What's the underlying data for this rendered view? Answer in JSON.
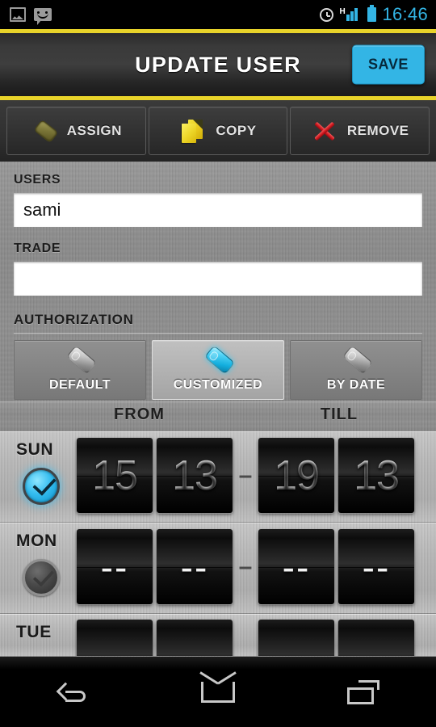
{
  "statusbar": {
    "icons": [
      "gallery-icon",
      "sms-icon",
      "alarm-icon",
      "signal-icon",
      "battery-icon"
    ],
    "network_type": "H",
    "clock": "16:46",
    "accent_color": "#33b5e5"
  },
  "titlebar": {
    "title": "UPDATE USER",
    "save_label": "SAVE",
    "accent_color": "#33b5e5",
    "border_color": "#e8d32a"
  },
  "actions": [
    {
      "label": "ASSIGN",
      "icon": "key-icon"
    },
    {
      "label": "COPY",
      "icon": "copy-pages-icon"
    },
    {
      "label": "REMOVE",
      "icon": "red-x-icon"
    }
  ],
  "form": {
    "users_label": "USERS",
    "users_value": "sami",
    "users_placeholder": "",
    "trade_label": "TRADE",
    "trade_value": "",
    "trade_placeholder": ""
  },
  "authorization": {
    "section_label": "AUTHORIZATION",
    "tabs": [
      {
        "label": "DEFAULT",
        "icon": "key-icon-grey",
        "selected": false
      },
      {
        "label": "CUSTOMIZED",
        "icon": "key-icon-blue",
        "selected": true
      },
      {
        "label": "BY DATE",
        "icon": "key-icon-grey",
        "selected": false
      }
    ]
  },
  "schedule": {
    "from_header": "FROM",
    "till_header": "TILL",
    "separator": "–",
    "rows": [
      {
        "day": "SUN",
        "enabled": true,
        "from_hour": "15",
        "from_min": "13",
        "till_hour": "19",
        "till_min": "13"
      },
      {
        "day": "MON",
        "enabled": false,
        "from_hour": "--",
        "from_min": "--",
        "till_hour": "--",
        "till_min": "--"
      },
      {
        "day": "TUE",
        "enabled": false,
        "from_hour": "",
        "from_min": "",
        "till_hour": "",
        "till_min": ""
      }
    ]
  },
  "navbar": {
    "back": "back-icon",
    "home": "home-icon",
    "recents": "recents-icon"
  }
}
